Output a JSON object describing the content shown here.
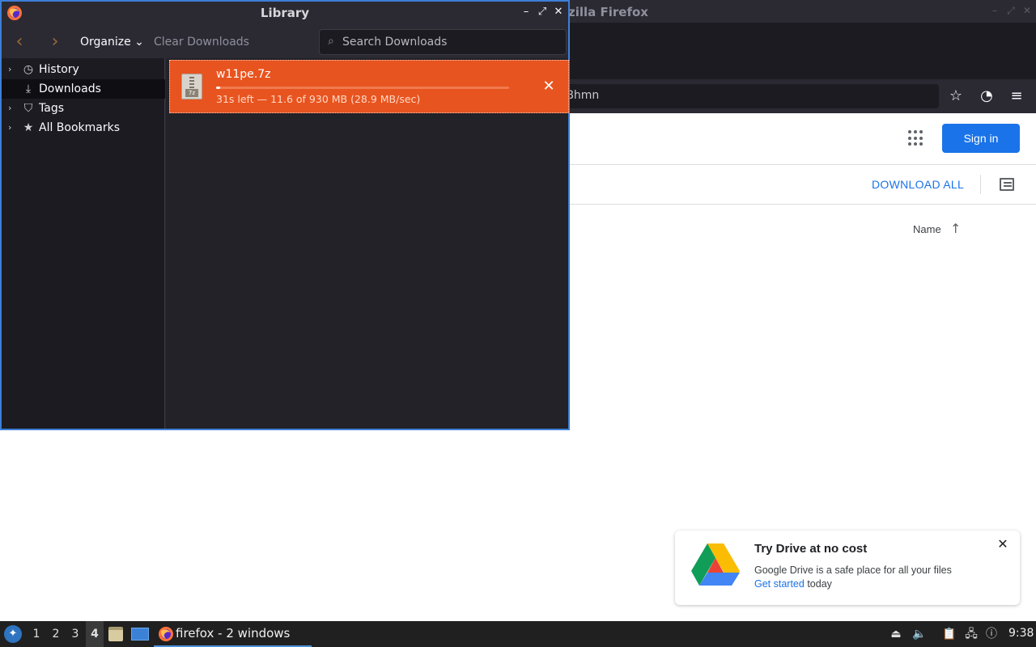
{
  "firefox": {
    "window_title": "zilla Firefox",
    "url_fragment": "8hmn"
  },
  "drive": {
    "signin_label": "Sign in",
    "download_all_label": "DOWNLOAD ALL",
    "sort_label": "Name",
    "promo": {
      "title": "Try Drive at no cost",
      "body": "Google Drive is a safe place for all your files",
      "link_label": "Get started",
      "link_suffix": " today"
    }
  },
  "library": {
    "title": "Library",
    "toolbar": {
      "organize_label": "Organize",
      "clear_downloads_label": "Clear Downloads",
      "search_placeholder": "Search Downloads"
    },
    "sidebar": {
      "items": [
        {
          "label": "History",
          "icon": "clock-icon",
          "expandable": true,
          "selected": false
        },
        {
          "label": "Downloads",
          "icon": "download-icon",
          "expandable": false,
          "selected": true
        },
        {
          "label": "Tags",
          "icon": "tag-icon",
          "expandable": true,
          "selected": false
        },
        {
          "label": "All Bookmarks",
          "icon": "star-icon",
          "expandable": true,
          "selected": false
        }
      ]
    },
    "downloads": [
      {
        "filename": "w11pe.7z",
        "status": "31s left — 11.6 of 930 MB (28.9 MB/sec)",
        "progress_fraction": 0.0125,
        "accent_color": "#e8541f"
      }
    ]
  },
  "taskbar": {
    "workspaces": [
      "1",
      "2",
      "3",
      "4"
    ],
    "active_workspace": "4",
    "task_label": "firefox - 2 windows",
    "clock": "9:38"
  }
}
